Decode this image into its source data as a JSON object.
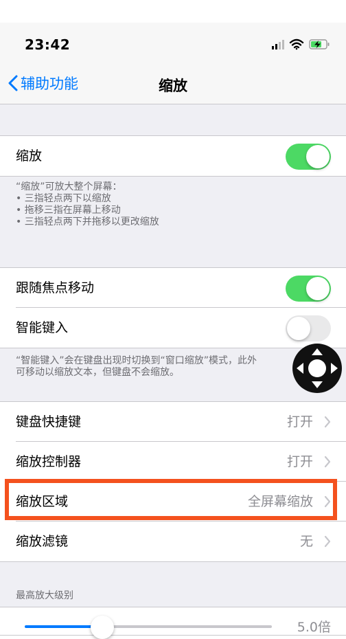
{
  "status": {
    "time": "23:42"
  },
  "nav": {
    "back_label": "辅助功能",
    "title": "缩放"
  },
  "zoom": {
    "label": "缩放",
    "enabled": true
  },
  "zoom_help": {
    "title": "“缩放”可放大整个屏幕：",
    "items": [
      "• 三指轻点两下以缩放",
      "• 拖移三指在屏幕上移动",
      "• 三指轻点两下并拖移以更改缩放"
    ]
  },
  "follow_focus": {
    "label": "跟随焦点移动",
    "enabled": true
  },
  "smart_typing": {
    "label": "智能键入",
    "enabled": false
  },
  "smart_help": {
    "line1": "“智能键入”会在键盘出现时切换到“窗口缩放”模式，此外",
    "line2": "可移动以缩放文本，但键盘不会缩放。"
  },
  "keyboard_shortcuts": {
    "label": "键盘快捷键",
    "value": "打开"
  },
  "zoom_controller": {
    "label": "缩放控制器",
    "value": "打开"
  },
  "zoom_region": {
    "label": "缩放区域",
    "value": "全屏幕缩放"
  },
  "zoom_filter": {
    "label": "缩放滤镜",
    "value": "无"
  },
  "max_zoom": {
    "header": "最高放大级别",
    "value": "5.0倍",
    "level": 0.3
  },
  "colors": {
    "accent": "#007aff",
    "toggle_on": "#4cd964",
    "highlight": "#f4511e"
  },
  "icons": [
    "signal-icon",
    "wifi-icon",
    "battery-charging-icon",
    "chevron-left-icon",
    "chevron-right-icon",
    "joystick-icon"
  ]
}
